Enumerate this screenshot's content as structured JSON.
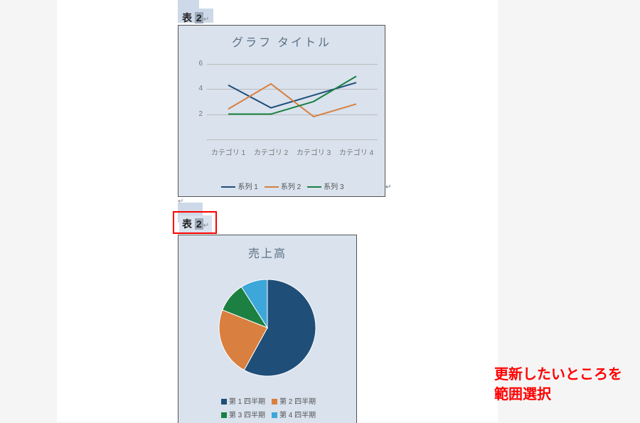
{
  "caption1_prefix": "表",
  "caption1_num": "2",
  "caption2_prefix": "表",
  "caption2_num": "2",
  "note_line1": "更新したいところを",
  "note_line2": "範囲選択",
  "chart_data": [
    {
      "type": "line",
      "title": "グラフ タイトル",
      "categories": [
        "カテゴリ 1",
        "カテゴリ 2",
        "カテゴリ 3",
        "カテゴリ 4"
      ],
      "series": [
        {
          "name": "系列 1",
          "color": "#1f4e79",
          "values": [
            4.3,
            2.5,
            3.5,
            4.5
          ]
        },
        {
          "name": "系列 2",
          "color": "#d97f3f",
          "values": [
            2.4,
            4.4,
            1.8,
            2.8
          ]
        },
        {
          "name": "系列 3",
          "color": "#1b8042",
          "values": [
            2.0,
            2.0,
            3.0,
            5.0
          ]
        }
      ],
      "yticks": [
        2,
        4,
        6
      ],
      "ylim": [
        0,
        6.2
      ]
    },
    {
      "type": "pie",
      "title": "売上高",
      "slices": [
        {
          "name": "第 1 四半期",
          "color": "#1f4e79",
          "value": 58
        },
        {
          "name": "第 2 四半期",
          "color": "#d97f3f",
          "value": 23
        },
        {
          "name": "第 3 四半期",
          "color": "#1b8042",
          "value": 10
        },
        {
          "name": "第 4 四半期",
          "color": "#3da7d9",
          "value": 9
        }
      ]
    }
  ]
}
